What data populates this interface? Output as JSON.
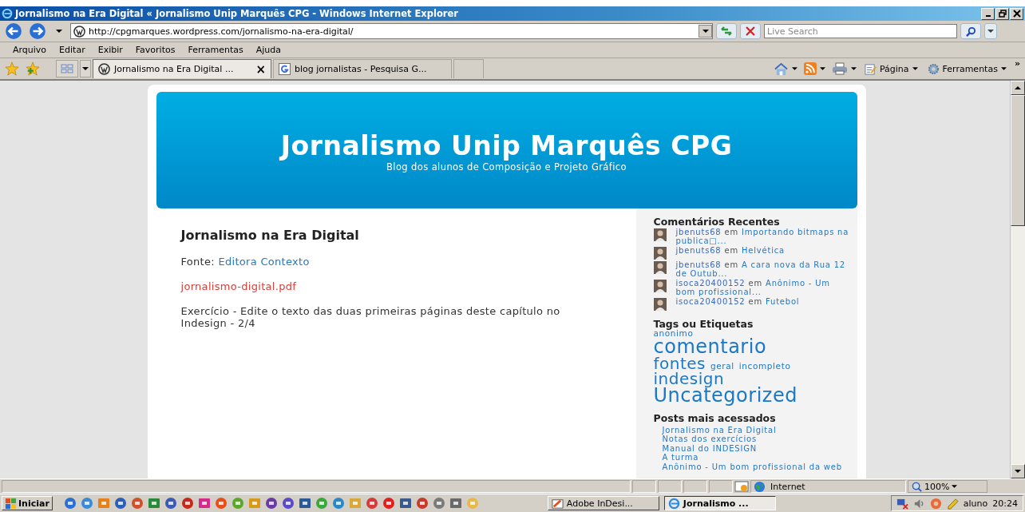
{
  "window": {
    "title": "Jornalismo na Era Digital « Jornalismo Unip Marquês CPG - Windows Internet Explorer"
  },
  "address_bar": {
    "url": "http://cpgmarques.wordpress.com/jornalismo-na-era-digital/"
  },
  "search": {
    "placeholder": "Live Search"
  },
  "menu": [
    "Arquivo",
    "Editar",
    "Exibir",
    "Favoritos",
    "Ferramentas",
    "Ajuda"
  ],
  "tabs": [
    {
      "label": "Jornalismo na Era Digital ...",
      "selected": true,
      "close": "×"
    },
    {
      "label": "blog jornalistas - Pesquisa G...",
      "selected": false
    }
  ],
  "command_bar": {
    "page": "Página",
    "tools": "Ferramentas",
    "more": "»"
  },
  "blog": {
    "title": "Jornalismo Unip Marquês CPG",
    "tagline": "Blog dos alunos de Composição e Projeto Gráfico"
  },
  "post": {
    "title": "Jornalismo na Era Digital",
    "source_label": "Fonte:",
    "source_link": "Editora Contexto",
    "file_link": "jornalismo-digital.pdf",
    "body": "Exercício - Edite o texto das duas primeiras páginas deste capítulo no Indesign - 2/4"
  },
  "sidebar": {
    "recent_comments": {
      "title": "Comentários Recentes",
      "items": [
        {
          "author": "jbenuts68",
          "joiner": "em",
          "post": "Importando bitmaps na publica□..."
        },
        {
          "author": "jbenuts68",
          "joiner": "em",
          "post": "Helvética"
        },
        {
          "author": "jbenuts68",
          "joiner": "em",
          "post": "A cara nova da Rua 12 de Outub..."
        },
        {
          "author": "isoca20400152",
          "joiner": "em",
          "post": "Anônimo - Um bom profissional..."
        },
        {
          "author": "isoca20400152",
          "joiner": "em",
          "post": "Futebol"
        }
      ]
    },
    "tags": {
      "title": "Tags ou Etiquetas",
      "items": [
        {
          "label": "anonimo",
          "kind": "small"
        },
        {
          "label": "comentario",
          "kind": "xlarge"
        },
        {
          "label": "fontes",
          "kind": "large"
        },
        {
          "label": "geral",
          "kind": "small"
        },
        {
          "label": "incompleto",
          "kind": "small"
        },
        {
          "label": "indesign",
          "kind": "large"
        },
        {
          "label": "Uncategorized",
          "kind": "xlarge"
        }
      ]
    },
    "popular_posts": {
      "title": "Posts mais acessados",
      "items": [
        "Jornalismo na Era Digital",
        "Notas dos exercícios",
        "Manual do INDESIGN",
        "A turma",
        "Anônimo - Um bom profissional da web"
      ]
    }
  },
  "status_bar": {
    "zone": "Internet",
    "zoom": "100%"
  },
  "taskbar": {
    "start": "Iniciar",
    "windows": [
      {
        "label": "Adobe InDesi...",
        "selected": false
      },
      {
        "label": "Jornalismo ...",
        "selected": true
      }
    ],
    "user": "aluno",
    "clock": "20:24"
  }
}
